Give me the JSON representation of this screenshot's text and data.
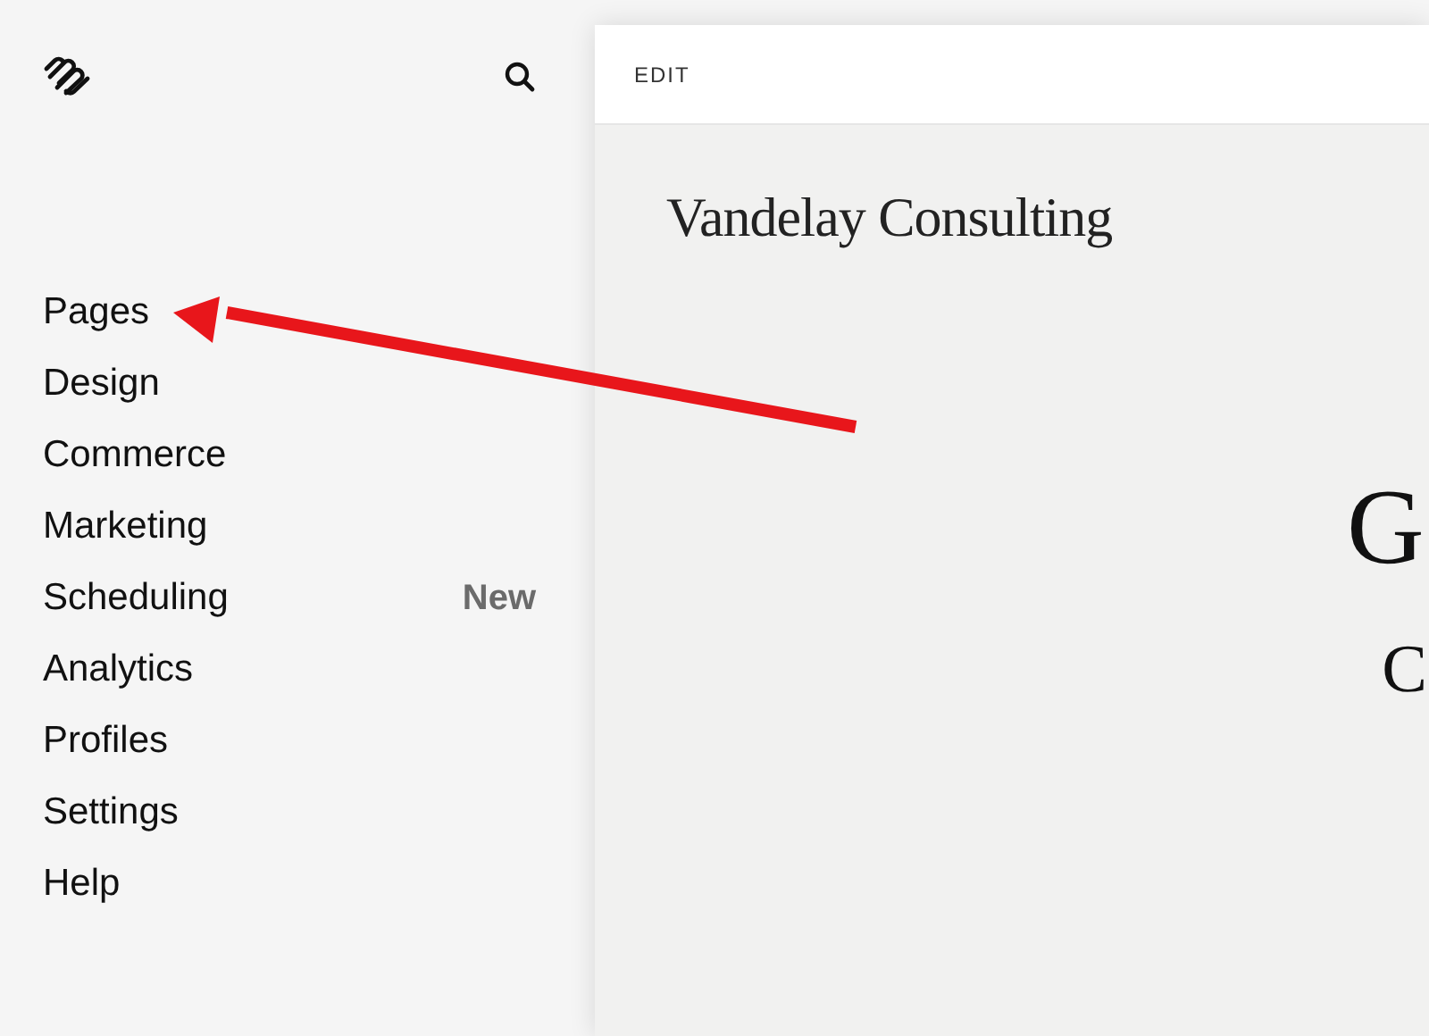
{
  "sidebar": {
    "items": [
      {
        "label": "Pages"
      },
      {
        "label": "Design"
      },
      {
        "label": "Commerce"
      },
      {
        "label": "Marketing"
      },
      {
        "label": "Scheduling",
        "badge": "New"
      },
      {
        "label": "Analytics"
      },
      {
        "label": "Profiles"
      },
      {
        "label": "Settings"
      },
      {
        "label": "Help"
      }
    ]
  },
  "editor": {
    "toolbar_label": "EDIT",
    "site_title": "Vandelay Consulting",
    "heading_fragments": [
      "G",
      "C"
    ]
  }
}
